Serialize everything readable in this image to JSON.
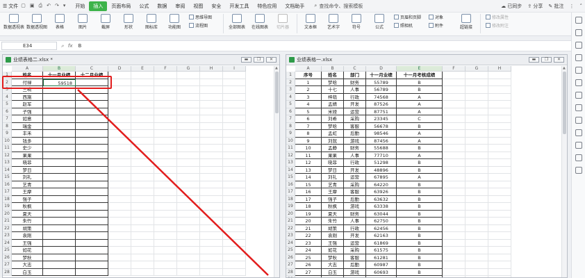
{
  "menubar": {
    "file_label": "文件",
    "tabs": [
      "开始",
      "插入",
      "页面布局",
      "公式",
      "数据",
      "审阅",
      "视图",
      "安全",
      "开发工具",
      "特色应用",
      "文档助手"
    ],
    "active_tab": 1,
    "search_placeholder": "查找命令、搜索模板",
    "right": {
      "sync": "已同步",
      "share": "分享",
      "annotate": "批注"
    }
  },
  "ribbon": {
    "buttons": [
      {
        "label": "数据透视表",
        "icon": "pivot-table-icon"
      },
      {
        "label": "数据透视图",
        "icon": "pivot-chart-icon"
      },
      {
        "label": "表格",
        "icon": "table-icon"
      },
      {
        "label": "图片",
        "icon": "picture-icon"
      },
      {
        "label": "截屏",
        "icon": "screenshot-icon"
      },
      {
        "label": "形状",
        "icon": "shape-icon"
      },
      {
        "label": "图标库",
        "icon": "icon-library-icon"
      },
      {
        "label": "功能图",
        "icon": "function-chart-icon"
      }
    ],
    "col1": [
      "思维导图",
      "流程图"
    ],
    "buttons2": [
      {
        "label": "全部图表",
        "icon": "all-charts-icon"
      },
      {
        "label": "在线图表",
        "icon": "online-chart-icon"
      }
    ],
    "gray_button": {
      "label": "切片器",
      "icon": "slicer-icon"
    },
    "buttons3": [
      {
        "label": "文本框",
        "icon": "textbox-icon"
      },
      {
        "label": "艺术字",
        "icon": "wordart-icon"
      },
      {
        "label": "符号",
        "icon": "symbol-icon"
      },
      {
        "label": "公式",
        "icon": "formula-icon"
      }
    ],
    "col2": [
      "页眉和页脚",
      "照相机"
    ],
    "col3": [
      "对象",
      "附件"
    ],
    "link_button": {
      "label": "超链接",
      "icon": "hyperlink-icon"
    },
    "col4": [
      "修改属性",
      "修改附注"
    ]
  },
  "formula_bar": {
    "cell_ref": "E34",
    "fx": "fx",
    "value": "B"
  },
  "left_window": {
    "title": "业绩表格二.xlsx *",
    "columns": [
      "A",
      "B",
      "C",
      "D",
      "E",
      "F",
      "G",
      "H",
      "I"
    ],
    "headers": [
      "姓名",
      "十一月业绩",
      "十二月业绩"
    ],
    "row1_values": {
      "name": "付禄",
      "value": "59518"
    },
    "names": [
      "三嗬",
      "西施",
      "赵军",
      "子强",
      "如意",
      "瑞金",
      "丰禾",
      "钱多",
      "史少",
      "果果",
      "晓菲",
      "梦日",
      "刘礼",
      "艺青",
      "王摩",
      "强子",
      "秋枫",
      "夏天",
      "朱竹",
      "胡策",
      "袁刚",
      "王强",
      "如花",
      "梦秋",
      "大志",
      "白玉"
    ],
    "row_numbers": [
      "1",
      "2",
      "3",
      "4",
      "5",
      "6",
      "7",
      "8",
      "9",
      "10",
      "11",
      "12",
      "13",
      "14",
      "15",
      "16",
      "17",
      "18",
      "19",
      "20",
      "21",
      "22",
      "23",
      "24",
      "25",
      "26",
      "27",
      "28"
    ]
  },
  "right_window": {
    "title": "业绩表格一.xlsx",
    "columns": [
      "A",
      "B",
      "C",
      "D",
      "E",
      "F",
      "G",
      "H"
    ],
    "headers": [
      "序号",
      "姓名",
      "部门",
      "十一月业绩",
      "十一月考核成绩"
    ],
    "rows": [
      [
        "1",
        "梦晗",
        "财务",
        "55789",
        "B"
      ],
      [
        "2",
        "十七",
        "人事",
        "56789",
        "B"
      ],
      [
        "3",
        "梓萌",
        "行政",
        "74568",
        "A"
      ],
      [
        "4",
        "孟婧",
        "开发",
        "87526",
        "A"
      ],
      [
        "5",
        "米娅",
        "运营",
        "87751",
        "A"
      ],
      [
        "6",
        "刘希",
        "采购",
        "23345",
        "C"
      ],
      [
        "7",
        "梦晗",
        "客服",
        "56678",
        "B"
      ],
      [
        "8",
        "孟虹",
        "后勤",
        "98546",
        "A"
      ],
      [
        "9",
        "刘就",
        "游戏",
        "87456",
        "A"
      ],
      [
        "10",
        "孟静",
        "财务",
        "55688",
        "B"
      ],
      [
        "11",
        "果果",
        "人事",
        "77710",
        "A"
      ],
      [
        "12",
        "晓菲",
        "行政",
        "51298",
        "B"
      ],
      [
        "13",
        "梦日",
        "开发",
        "48896",
        "B"
      ],
      [
        "14",
        "刘礼",
        "运营",
        "67895",
        "A"
      ],
      [
        "15",
        "艺青",
        "采购",
        "64220",
        "B"
      ],
      [
        "16",
        "王摩",
        "客服",
        "63926",
        "B"
      ],
      [
        "17",
        "强子",
        "后勤",
        "63632",
        "B"
      ],
      [
        "18",
        "秋枫",
        "游戏",
        "63338",
        "B"
      ],
      [
        "19",
        "夏天",
        "财务",
        "63044",
        "B"
      ],
      [
        "20",
        "朱竹",
        "人事",
        "62750",
        "B"
      ],
      [
        "21",
        "胡策",
        "行政",
        "62456",
        "B"
      ],
      [
        "22",
        "袁刚",
        "开发",
        "62163",
        "B"
      ],
      [
        "23",
        "王强",
        "运营",
        "61869",
        "B"
      ],
      [
        "24",
        "如花",
        "采购",
        "61575",
        "B"
      ],
      [
        "25",
        "梦秋",
        "客服",
        "61281",
        "B"
      ],
      [
        "26",
        "大志",
        "后勤",
        "60987",
        "B"
      ],
      [
        "27",
        "白玉",
        "游戏",
        "60693",
        "B"
      ]
    ],
    "row_numbers": [
      "1",
      "2",
      "3",
      "4",
      "5",
      "6",
      "7",
      "8",
      "9",
      "10",
      "11",
      "12",
      "13",
      "14",
      "15",
      "16",
      "17",
      "18",
      "19",
      "20",
      "21",
      "22",
      "23",
      "24",
      "25",
      "26",
      "27",
      "28",
      "29"
    ]
  },
  "colors": {
    "accent_green": "#3db34a",
    "callout_red": "#e21d1d"
  }
}
